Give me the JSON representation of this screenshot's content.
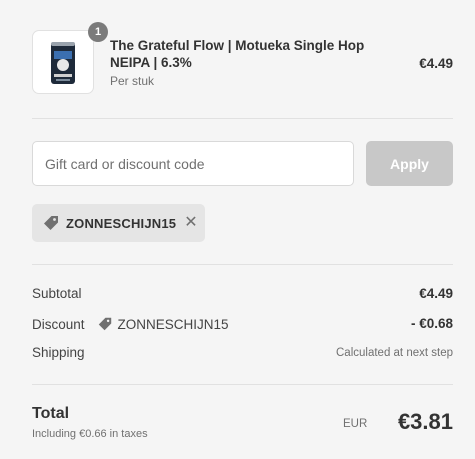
{
  "line_item": {
    "quantity": "1",
    "name": "The Grateful Flow | Motueka Single Hop NEIPA | 6.3%",
    "unit": "Per stuk",
    "price": "€4.49"
  },
  "discount": {
    "placeholder": "Gift card or discount code",
    "apply_label": "Apply",
    "applied_code": "ZONNESCHIJN15"
  },
  "summary": {
    "subtotal_label": "Subtotal",
    "subtotal_value": "€4.49",
    "discount_label": "Discount",
    "discount_code": "ZONNESCHIJN15",
    "discount_value": "- €0.68",
    "shipping_label": "Shipping",
    "shipping_value": "Calculated at next step"
  },
  "total": {
    "label": "Total",
    "taxes_note": "Including €0.66 in taxes",
    "currency": "EUR",
    "value": "€3.81"
  },
  "colors": {
    "background": "#f5f5f5",
    "apply_disabled": "#c8c8c8",
    "chip_background": "#e5e5e5",
    "badge": "#7b7b7b"
  },
  "icons": [
    "product-can-image",
    "tag-icon",
    "close-icon"
  ]
}
